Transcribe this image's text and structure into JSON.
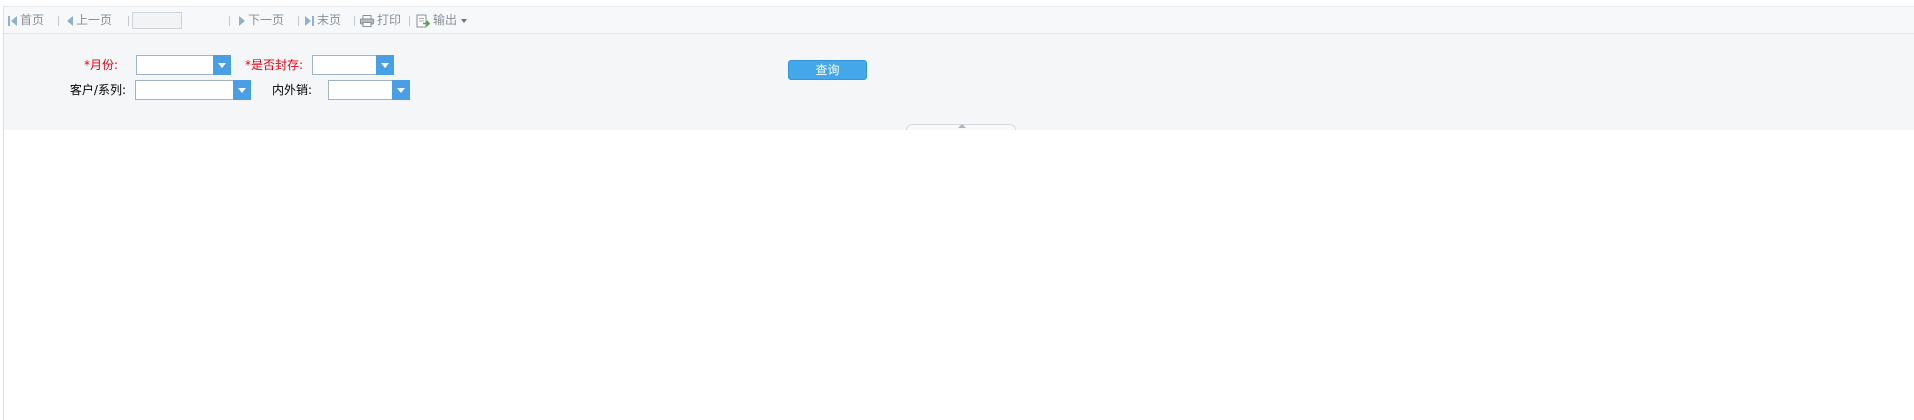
{
  "toolbar": {
    "first_label": "首页",
    "prev_label": "上一页",
    "page_value": "",
    "next_label": "下一页",
    "last_label": "末页",
    "print_label": "打印",
    "export_label": "输出"
  },
  "form": {
    "month_label": "*月份:",
    "month_value": "",
    "sealed_label": "*是否封存:",
    "sealed_value": "",
    "customer_label": "客户/系列:",
    "customer_value": "",
    "sales_label": "内外销:",
    "sales_value": "",
    "query_label": "查询"
  },
  "colors": {
    "accent": "#43a7ea",
    "required": "#e60012",
    "panel_bg": "#f4f6f8"
  }
}
